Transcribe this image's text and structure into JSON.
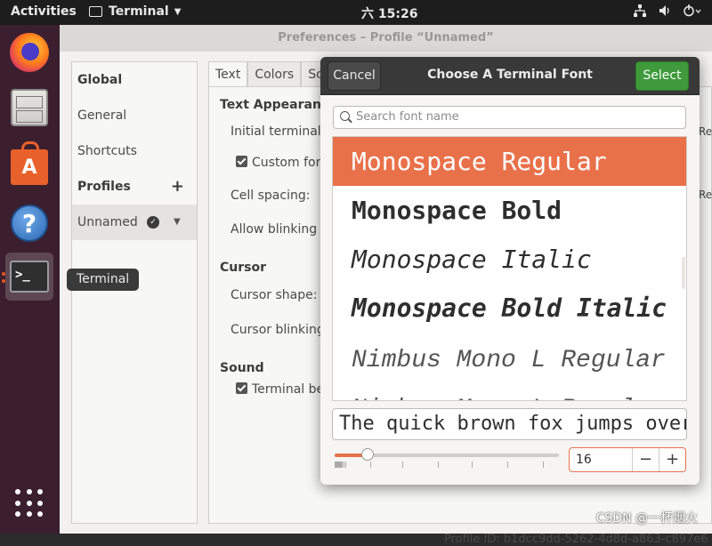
{
  "topbar": {
    "activities": "Activities",
    "app_name": "Terminal",
    "clock": "六 15:26",
    "network_icon": "network-icon",
    "volume_icon": "volume-icon",
    "power_icon": "power-icon"
  },
  "dock": {
    "items": [
      "firefox-icon",
      "files-icon",
      "software-icon",
      "help-icon",
      "terminal-icon"
    ],
    "help_glyph": "?",
    "software_glyph": "A",
    "terminal_glyph": ">_",
    "tooltip": "Terminal"
  },
  "prefs": {
    "title": "Preferences – Profile “Unnamed”",
    "sidebar": {
      "global": "Global",
      "general": "General",
      "shortcuts": "Shortcuts",
      "profiles": "Profiles",
      "add": "+",
      "profile_name": "Unnamed"
    },
    "tabs": [
      "Text",
      "Colors",
      "Sc"
    ],
    "text_appearance": "Text Appearanc",
    "initial_terminal": "Initial terminal",
    "custom_font": "Custom fon",
    "cell_spacing": "Cell spacing:",
    "allow_blinking": "Allow blinking t",
    "cursor": "Cursor",
    "cursor_shape": "Cursor shape:",
    "cursor_blinking": "Cursor blinking",
    "sound": "Sound",
    "terminal_bell": "Terminal be",
    "edge_re_1": "Re",
    "edge_re_2": "Re",
    "profile_id": "Profile ID:  b1dcc9dd-5262-4d8d-a863-c897e6"
  },
  "font_dialog": {
    "cancel": "Cancel",
    "title": "Choose A Terminal Font",
    "select": "Select",
    "search_placeholder": "Search font name",
    "fonts": [
      "Monospace Regular",
      "Monospace Bold",
      "Monospace Italic",
      "Monospace Bold Italic",
      "Nimbus Mono L Regular",
      "Nimbus Mono L Regular"
    ],
    "selected_index": 0,
    "preview_text": "The quick brown fox jumps over",
    "size": "16",
    "minus": "−",
    "plus": "+",
    "size_fraction": 0.15
  },
  "watermark": "CSDN @一杯烟火"
}
